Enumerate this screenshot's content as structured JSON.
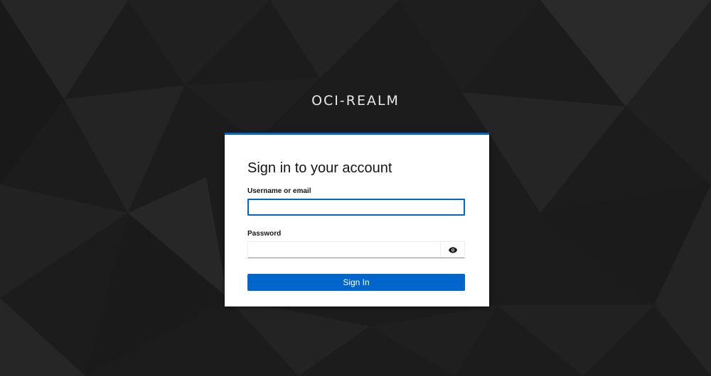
{
  "realm": {
    "title": "OCI-REALM"
  },
  "login": {
    "heading": "Sign in to your account",
    "username_label": "Username or email",
    "username_value": "",
    "password_label": "Password",
    "password_value": "",
    "submit_label": "Sign In"
  },
  "icons": {
    "reveal_password": "eye-icon"
  },
  "colors": {
    "background": "#1c1c1c",
    "accent": "#0066cc",
    "card": "#ffffff",
    "title_text": "#e8e8e8"
  }
}
